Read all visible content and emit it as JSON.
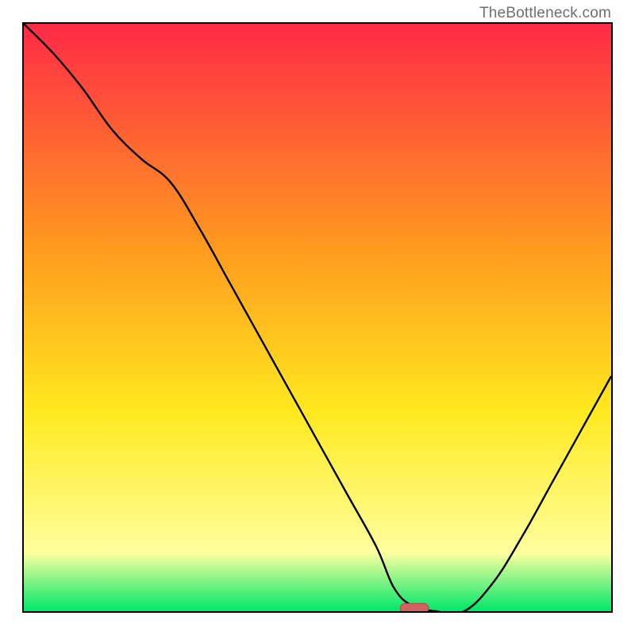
{
  "attribution": "TheBottleneck.com",
  "palette": {
    "red": "#ff2a47",
    "orange": "#ff9a1f",
    "yellow": "#ffe91f",
    "light_yellow": "#ffff9e",
    "green": "#00e66a",
    "line": "#000000",
    "marker_fill": "#d0635f",
    "marker_stroke": "#a84d4a"
  },
  "chart_data": {
    "type": "line",
    "title": "",
    "xlabel": "",
    "ylabel": "",
    "xlim": [
      0,
      100
    ],
    "ylim": [
      0,
      100
    ],
    "x": [
      0,
      5,
      10,
      15,
      20,
      25,
      30,
      35,
      40,
      45,
      50,
      55,
      60,
      63,
      66,
      70,
      75,
      80,
      85,
      90,
      95,
      100
    ],
    "y": [
      100,
      95,
      89,
      82,
      77,
      73,
      65,
      56,
      47,
      38,
      29,
      20,
      11,
      4,
      1,
      0,
      0,
      5,
      13,
      22,
      31,
      40
    ],
    "optimum_zone_x": [
      63,
      70
    ],
    "marker": {
      "x": 66.5,
      "y": 0.5
    }
  }
}
